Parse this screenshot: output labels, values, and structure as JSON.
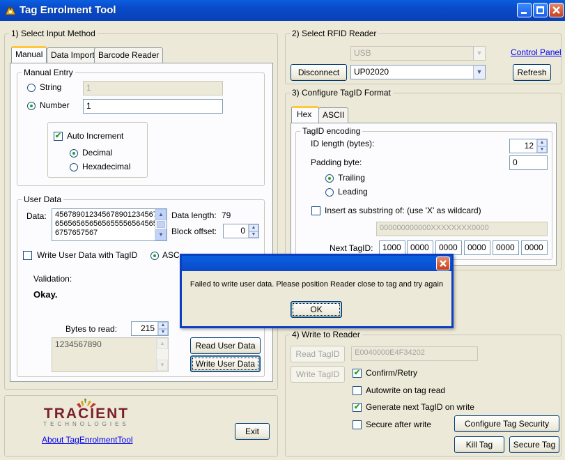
{
  "window": {
    "title": "Tag Enrolment Tool"
  },
  "input_method": {
    "group_label": "1) Select Input Method",
    "tabs": [
      "Manual",
      "Data Import",
      "Barcode Reader"
    ],
    "manual_entry": {
      "label": "Manual Entry",
      "string_label": "String",
      "string_value": "1",
      "number_label": "Number",
      "number_value": "1",
      "auto_increment_label": "Auto Increment",
      "decimal_label": "Decimal",
      "hex_label": "Hexadecimal"
    },
    "user_data": {
      "label": "User Data",
      "data_label": "Data:",
      "data_lines": [
        "456789012345678901234567",
        "656565656565655556564565",
        "6757657567"
      ],
      "data_length_label": "Data length:",
      "data_length_value": "79",
      "block_offset_label": "Block offset:",
      "block_offset_value": "0",
      "write_with_tagid_label": "Write User Data with TagID",
      "ascii_label": "ASC",
      "validation_label": "Validation:",
      "validation_value": "Okay.",
      "bytes_to_read_label": "Bytes to read:",
      "bytes_to_read_value": "215",
      "read_value": "1234567890",
      "read_button": "Read User Data",
      "write_button": "Write User Data"
    }
  },
  "rfid_reader": {
    "group_label": "2) Select RFID Reader",
    "connection_value": "USB",
    "control_panel_link": "Control Panel",
    "disconnect_button": "Disconnect",
    "reader_value": "UP02020",
    "refresh_button": "Refresh"
  },
  "tagid_format": {
    "group_label": "3) Configure TagID Format",
    "tabs": [
      "Hex",
      "ASCII"
    ],
    "encoding_label": "TagID encoding",
    "id_length_label": "ID length (bytes):",
    "id_length_value": "12",
    "padding_label": "Padding byte:",
    "padding_value": "0",
    "trailing_label": "Trailing",
    "leading_label": "Leading",
    "substring_label": "Insert as substring of: (use 'X' as wildcard)",
    "substring_value": "000000000000XXXXXXXX0000",
    "next_tagid_label": "Next TagID:",
    "next_tagid_values": [
      "1000",
      "0000",
      "0000",
      "0000",
      "0000",
      "0000"
    ]
  },
  "write_reader": {
    "group_label": "4) Write to Reader",
    "read_tagid_button": "Read TagID",
    "tagid_value": "E0040000E4F34202",
    "write_tagid_button": "Write TagID",
    "confirm_retry_label": "Confirm/Retry",
    "autowrite_label": "Autowrite on tag read",
    "generate_next_label": "Generate next TagID on write",
    "secure_after_label": "Secure after write",
    "configure_security_button": "Configure Tag Security",
    "kill_tag_button": "Kill Tag",
    "secure_tag_button": "Secure Tag"
  },
  "footer": {
    "logo_name": "TRACIENT",
    "logo_sub": "TECHNOLOGIES",
    "about_link": "About TagEnrolmentTool",
    "exit_button": "Exit"
  },
  "dialog": {
    "message": "Failed to write user data. Please position Reader close to tag and try again",
    "ok_button": "OK"
  },
  "colors": {
    "titlebar": "#0a4ac8",
    "face": "#ece9d8",
    "link": "#0000ee",
    "check": "#21a121",
    "close": "#c8401c"
  }
}
